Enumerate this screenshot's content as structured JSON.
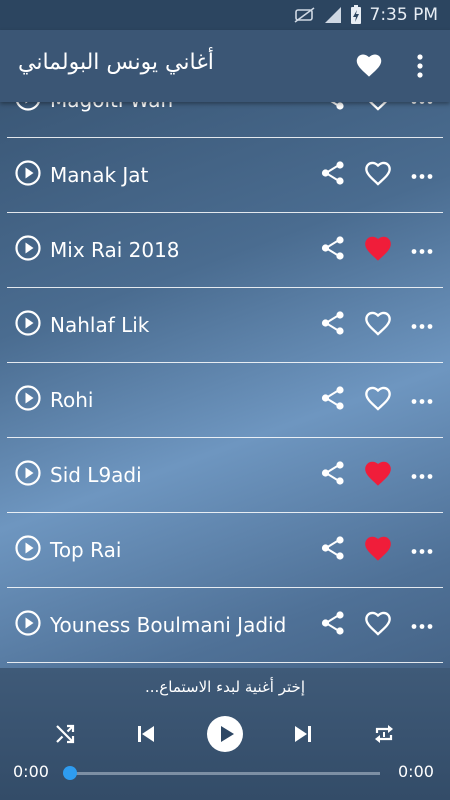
{
  "status_bar": {
    "time": "7:35 PM"
  },
  "app_bar": {
    "title": "أغاني يونس البولماني"
  },
  "songs": [
    {
      "title": "Magolti Wah",
      "favorite": false
    },
    {
      "title": "Manak Jat",
      "favorite": false
    },
    {
      "title": "Mix Rai 2018",
      "favorite": true
    },
    {
      "title": "Nahlaf Lik",
      "favorite": false
    },
    {
      "title": "Rohi",
      "favorite": false
    },
    {
      "title": "Sid L9adi",
      "favorite": true
    },
    {
      "title": "Top Rai",
      "favorite": true
    },
    {
      "title": "Youness Boulmani Jadid",
      "favorite": false
    }
  ],
  "player": {
    "now_playing": "إختر أغنية لبدء الاستماع...",
    "elapsed": "0:00",
    "duration": "0:00",
    "progress": 0
  },
  "colors": {
    "heart_favorite": "#f01d3a",
    "accent": "#2e9cf0"
  },
  "icons": [
    "play-circle-icon",
    "share-icon",
    "heart-icon",
    "more-horizontal-icon",
    "shuffle-icon",
    "previous-icon",
    "play-icon",
    "next-icon",
    "repeat-icon"
  ]
}
